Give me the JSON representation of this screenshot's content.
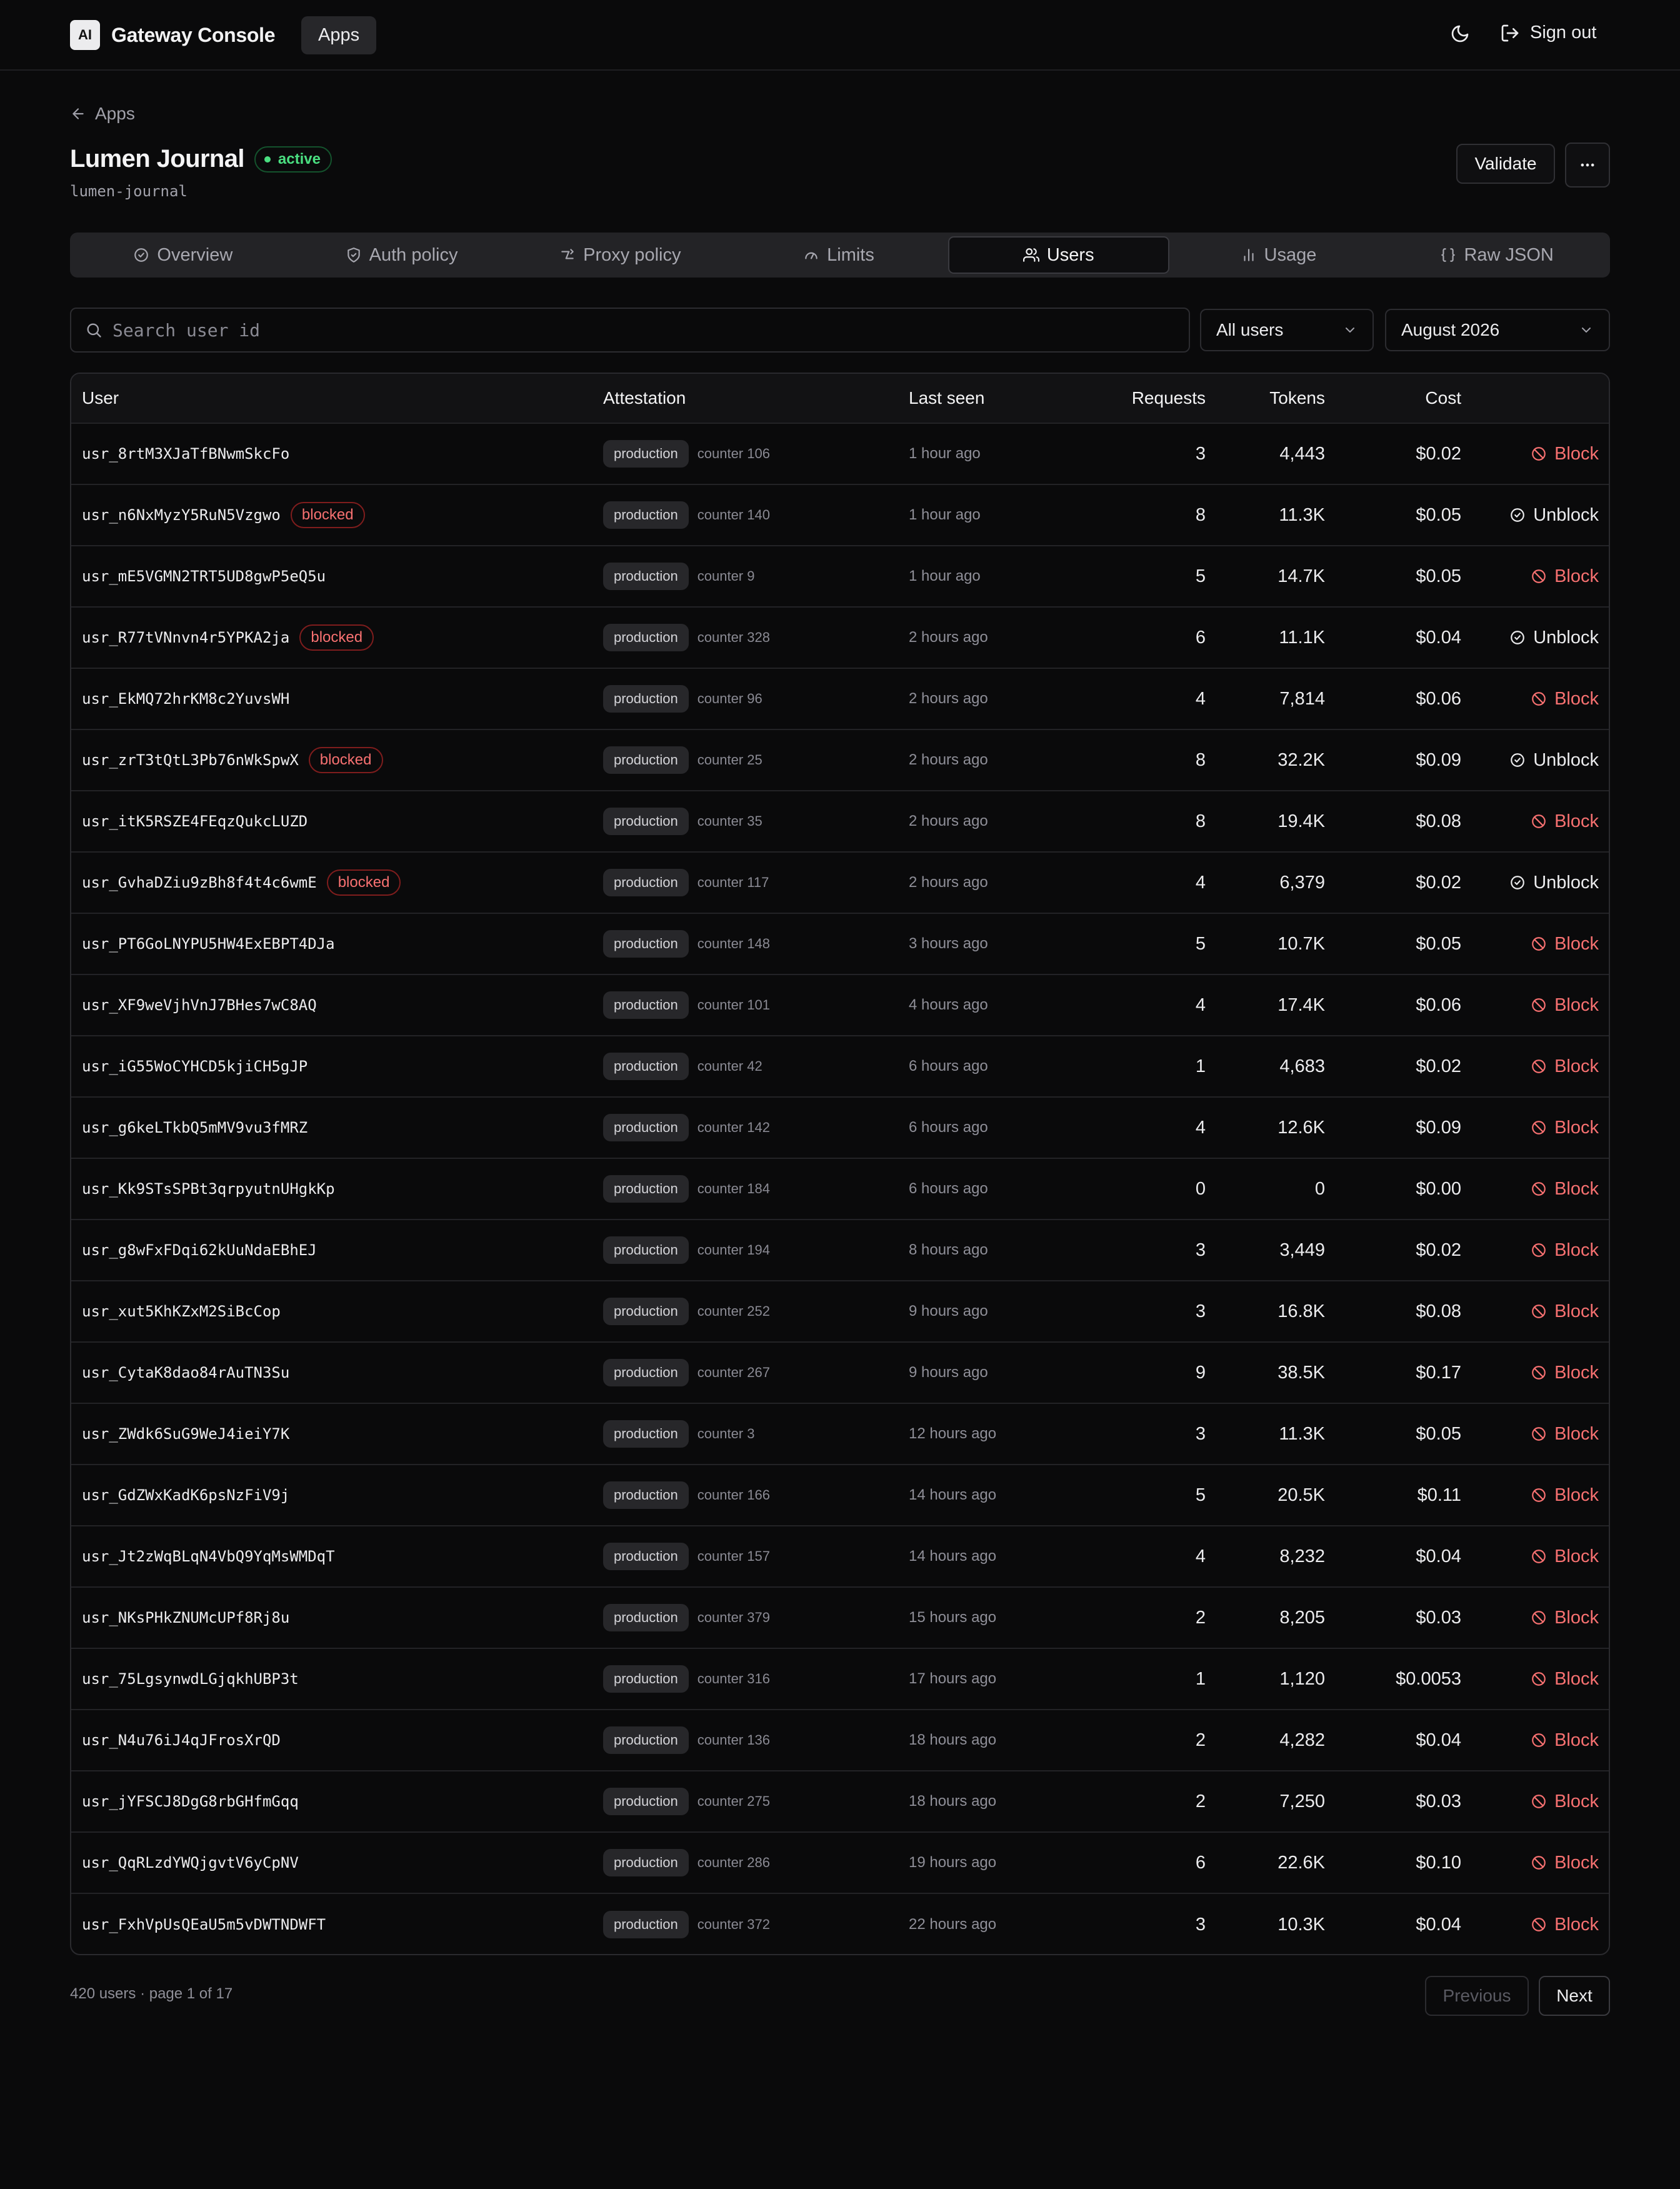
{
  "header": {
    "brand_logo": "AI",
    "brand_name": "Gateway Console",
    "nav_apps": "Apps",
    "sign_out": "Sign out",
    "theme_icon": "moon-icon"
  },
  "page": {
    "back_label": "Apps",
    "title": "Lumen Journal",
    "status": "active",
    "slug": "lumen-journal",
    "validate_label": "Validate",
    "more_icon": "ellipsis-icon"
  },
  "tabs": [
    {
      "label": "Overview",
      "icon": "check-circle-icon",
      "active": false
    },
    {
      "label": "Auth policy",
      "icon": "shield-icon",
      "active": false
    },
    {
      "label": "Proxy policy",
      "icon": "route-icon",
      "active": false
    },
    {
      "label": "Limits",
      "icon": "gauge-icon",
      "active": false
    },
    {
      "label": "Users",
      "icon": "users-icon",
      "active": true
    },
    {
      "label": "Usage",
      "icon": "bar-chart-icon",
      "active": false
    },
    {
      "label": "Raw JSON",
      "icon": "braces-icon",
      "active": false
    }
  ],
  "filters": {
    "search_placeholder": "Search user id",
    "search_value": "",
    "user_filter": "All users",
    "month": "August 2026"
  },
  "table": {
    "columns": {
      "user": "User",
      "attestation": "Attestation",
      "last_seen": "Last seen",
      "requests": "Requests",
      "tokens": "Tokens",
      "cost": "Cost"
    },
    "rows": [
      {
        "user": "usr_8rtM3XJaTfBNwmSkcFo",
        "blocked": false,
        "env": "production",
        "counter": "counter 106",
        "last_seen": "1 hour ago",
        "requests": "3",
        "tokens": "4,443",
        "cost": "$0.02",
        "action": "Block"
      },
      {
        "user": "usr_n6NxMyzY5RuN5Vzgwo",
        "blocked": true,
        "env": "production",
        "counter": "counter 140",
        "last_seen": "1 hour ago",
        "requests": "8",
        "tokens": "11.3K",
        "cost": "$0.05",
        "action": "Unblock"
      },
      {
        "user": "usr_mE5VGMN2TRT5UD8gwP5eQ5u",
        "blocked": false,
        "env": "production",
        "counter": "counter 9",
        "last_seen": "1 hour ago",
        "requests": "5",
        "tokens": "14.7K",
        "cost": "$0.05",
        "action": "Block"
      },
      {
        "user": "usr_R77tVNnvn4r5YPKA2ja",
        "blocked": true,
        "env": "production",
        "counter": "counter 328",
        "last_seen": "2 hours ago",
        "requests": "6",
        "tokens": "11.1K",
        "cost": "$0.04",
        "action": "Unblock"
      },
      {
        "user": "usr_EkMQ72hrKM8c2YuvsWH",
        "blocked": false,
        "env": "production",
        "counter": "counter 96",
        "last_seen": "2 hours ago",
        "requests": "4",
        "tokens": "7,814",
        "cost": "$0.06",
        "action": "Block"
      },
      {
        "user": "usr_zrT3tQtL3Pb76nWkSpwX",
        "blocked": true,
        "env": "production",
        "counter": "counter 25",
        "last_seen": "2 hours ago",
        "requests": "8",
        "tokens": "32.2K",
        "cost": "$0.09",
        "action": "Unblock"
      },
      {
        "user": "usr_itK5RSZE4FEqzQukcLUZD",
        "blocked": false,
        "env": "production",
        "counter": "counter 35",
        "last_seen": "2 hours ago",
        "requests": "8",
        "tokens": "19.4K",
        "cost": "$0.08",
        "action": "Block"
      },
      {
        "user": "usr_GvhaDZiu9zBh8f4t4c6wmE",
        "blocked": true,
        "env": "production",
        "counter": "counter 117",
        "last_seen": "2 hours ago",
        "requests": "4",
        "tokens": "6,379",
        "cost": "$0.02",
        "action": "Unblock"
      },
      {
        "user": "usr_PT6GoLNYPU5HW4ExEBPT4DJa",
        "blocked": false,
        "env": "production",
        "counter": "counter 148",
        "last_seen": "3 hours ago",
        "requests": "5",
        "tokens": "10.7K",
        "cost": "$0.05",
        "action": "Block"
      },
      {
        "user": "usr_XF9weVjhVnJ7BHes7wC8AQ",
        "blocked": false,
        "env": "production",
        "counter": "counter 101",
        "last_seen": "4 hours ago",
        "requests": "4",
        "tokens": "17.4K",
        "cost": "$0.06",
        "action": "Block"
      },
      {
        "user": "usr_iG55WoCYHCD5kjiCH5gJP",
        "blocked": false,
        "env": "production",
        "counter": "counter 42",
        "last_seen": "6 hours ago",
        "requests": "1",
        "tokens": "4,683",
        "cost": "$0.02",
        "action": "Block"
      },
      {
        "user": "usr_g6keLTkbQ5mMV9vu3fMRZ",
        "blocked": false,
        "env": "production",
        "counter": "counter 142",
        "last_seen": "6 hours ago",
        "requests": "4",
        "tokens": "12.6K",
        "cost": "$0.09",
        "action": "Block"
      },
      {
        "user": "usr_Kk9STsSPBt3qrpyutnUHgkKp",
        "blocked": false,
        "env": "production",
        "counter": "counter 184",
        "last_seen": "6 hours ago",
        "requests": "0",
        "tokens": "0",
        "cost": "$0.00",
        "action": "Block"
      },
      {
        "user": "usr_g8wFxFDqi62kUuNdaEBhEJ",
        "blocked": false,
        "env": "production",
        "counter": "counter 194",
        "last_seen": "8 hours ago",
        "requests": "3",
        "tokens": "3,449",
        "cost": "$0.02",
        "action": "Block"
      },
      {
        "user": "usr_xut5KhKZxM2SiBcCop",
        "blocked": false,
        "env": "production",
        "counter": "counter 252",
        "last_seen": "9 hours ago",
        "requests": "3",
        "tokens": "16.8K",
        "cost": "$0.08",
        "action": "Block"
      },
      {
        "user": "usr_CytaK8dao84rAuTN3Su",
        "blocked": false,
        "env": "production",
        "counter": "counter 267",
        "last_seen": "9 hours ago",
        "requests": "9",
        "tokens": "38.5K",
        "cost": "$0.17",
        "action": "Block"
      },
      {
        "user": "usr_ZWdk6SuG9WeJ4ieiY7K",
        "blocked": false,
        "env": "production",
        "counter": "counter 3",
        "last_seen": "12 hours ago",
        "requests": "3",
        "tokens": "11.3K",
        "cost": "$0.05",
        "action": "Block"
      },
      {
        "user": "usr_GdZWxKadK6psNzFiV9j",
        "blocked": false,
        "env": "production",
        "counter": "counter 166",
        "last_seen": "14 hours ago",
        "requests": "5",
        "tokens": "20.5K",
        "cost": "$0.11",
        "action": "Block"
      },
      {
        "user": "usr_Jt2zWqBLqN4VbQ9YqMsWMDqT",
        "blocked": false,
        "env": "production",
        "counter": "counter 157",
        "last_seen": "14 hours ago",
        "requests": "4",
        "tokens": "8,232",
        "cost": "$0.04",
        "action": "Block"
      },
      {
        "user": "usr_NKsPHkZNUMcUPf8Rj8u",
        "blocked": false,
        "env": "production",
        "counter": "counter 379",
        "last_seen": "15 hours ago",
        "requests": "2",
        "tokens": "8,205",
        "cost": "$0.03",
        "action": "Block"
      },
      {
        "user": "usr_75LgsynwdLGjqkhUBP3t",
        "blocked": false,
        "env": "production",
        "counter": "counter 316",
        "last_seen": "17 hours ago",
        "requests": "1",
        "tokens": "1,120",
        "cost": "$0.0053",
        "action": "Block"
      },
      {
        "user": "usr_N4u76iJ4qJFrosXrQD",
        "blocked": false,
        "env": "production",
        "counter": "counter 136",
        "last_seen": "18 hours ago",
        "requests": "2",
        "tokens": "4,282",
        "cost": "$0.04",
        "action": "Block"
      },
      {
        "user": "usr_jYFSCJ8DgG8rbGHfmGqq",
        "blocked": false,
        "env": "production",
        "counter": "counter 275",
        "last_seen": "18 hours ago",
        "requests": "2",
        "tokens": "7,250",
        "cost": "$0.03",
        "action": "Block"
      },
      {
        "user": "usr_QqRLzdYWQjgvtV6yCpNV",
        "blocked": false,
        "env": "production",
        "counter": "counter 286",
        "last_seen": "19 hours ago",
        "requests": "6",
        "tokens": "22.6K",
        "cost": "$0.10",
        "action": "Block"
      },
      {
        "user": "usr_FxhVpUsQEaU5m5vDWTNDWFT",
        "blocked": false,
        "env": "production",
        "counter": "counter 372",
        "last_seen": "22 hours ago",
        "requests": "3",
        "tokens": "10.3K",
        "cost": "$0.04",
        "action": "Block"
      }
    ],
    "blocked_label": "blocked"
  },
  "pagination": {
    "info": "420 users · page 1 of 17",
    "previous": "Previous",
    "next": "Next"
  },
  "colors": {
    "background": "#0a0a0b",
    "accent_active": "#4ade80",
    "danger": "#f87171"
  }
}
